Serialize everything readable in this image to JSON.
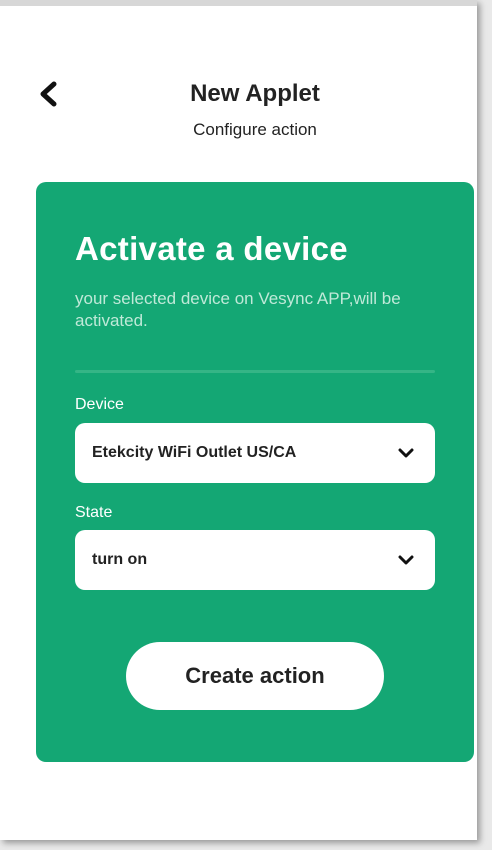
{
  "header": {
    "title": "New Applet",
    "subtitle": "Configure action",
    "back_icon": "chevron-left-icon"
  },
  "card": {
    "background_color": "#14a774",
    "title": "Activate a device",
    "description": "your selected device on Vesync APP,will be activated.",
    "fields": [
      {
        "label": "Device",
        "value": "Etekcity WiFi Outlet US/CA",
        "icon": "chevron-down-icon"
      },
      {
        "label": "State",
        "value": "turn on",
        "icon": "chevron-down-icon"
      }
    ],
    "create_button_label": "Create action"
  }
}
